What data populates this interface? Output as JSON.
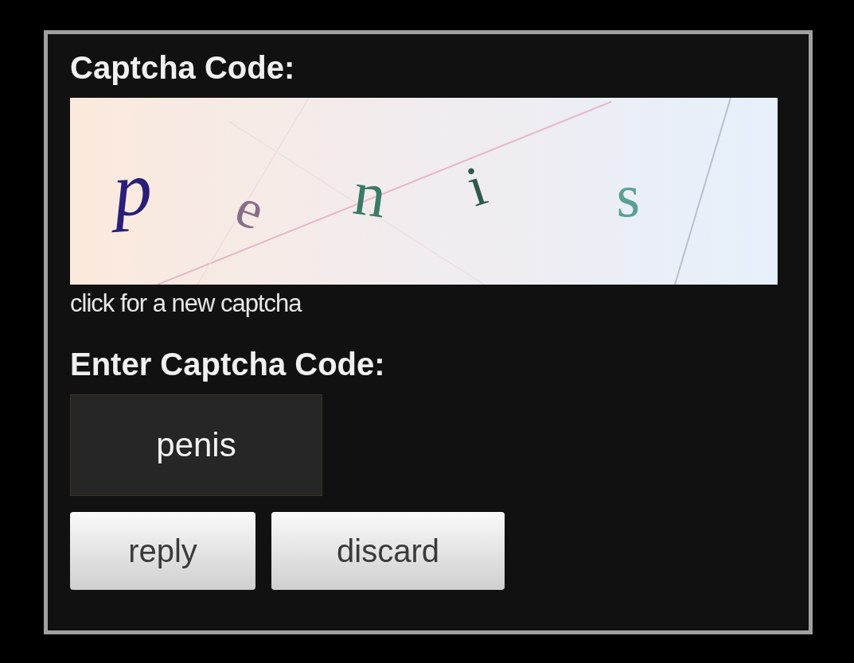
{
  "form": {
    "title": "Captcha Code:",
    "captcha_letters": [
      {
        "text": "p",
        "color": "#2a1e78"
      },
      {
        "text": "e",
        "color": "#8a6e88"
      },
      {
        "text": "n",
        "color": "#3c7a68"
      },
      {
        "text": "i",
        "color": "#2f5a4a"
      },
      {
        "text": "s",
        "color": "#5aa090"
      }
    ],
    "new_captcha_link": "click for a new captcha",
    "input_label": "Enter Captcha Code:",
    "input_value": "penis",
    "buttons": [
      "reply",
      "discard"
    ]
  }
}
